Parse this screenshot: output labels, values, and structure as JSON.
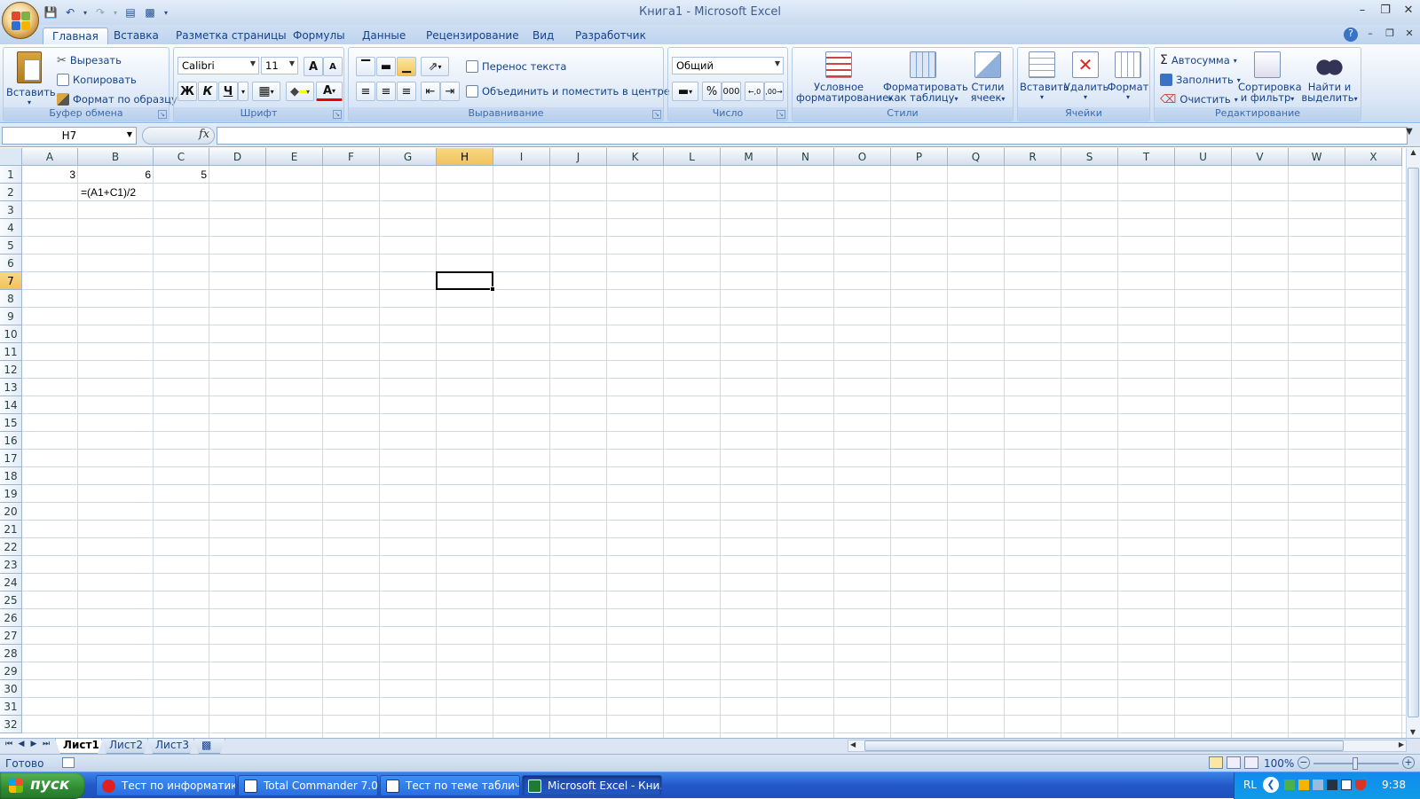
{
  "window": {
    "title": "Книга1 - Microsoft Excel"
  },
  "ribbon_tabs": [
    "Главная",
    "Вставка",
    "Разметка страницы",
    "Формулы",
    "Данные",
    "Рецензирование",
    "Вид",
    "Разработчик"
  ],
  "clipboard": {
    "paste": "Вставить",
    "cut": "Вырезать",
    "copy": "Копировать",
    "format_painter": "Формат по образцу",
    "label": "Буфер обмена"
  },
  "font": {
    "name": "Calibri",
    "size": "11",
    "bold": "Ж",
    "italic": "К",
    "underline": "Ч",
    "grow": "A",
    "shrink": "A",
    "label": "Шрифт"
  },
  "alignment": {
    "wrap": "Перенос текста",
    "merge": "Объединить и поместить в центре",
    "label": "Выравнивание"
  },
  "number": {
    "format": "Общий",
    "percent": "%",
    "thousands": "000",
    "inc_dec": ",0 ,00",
    "dec_dec": ",00 ,0",
    "label": "Число"
  },
  "styles": {
    "conditional": "Условное форматирование",
    "as_table": "Форматировать как таблицу",
    "cell_styles": "Стили ячеек",
    "label": "Стили"
  },
  "cells": {
    "insert": "Вставить",
    "delete": "Удалить",
    "format": "Формат",
    "label": "Ячейки"
  },
  "editing": {
    "autosum": "Автосумма",
    "fill": "Заполнить",
    "clear": "Очистить",
    "sort": "Сортировка и фильтр",
    "find": "Найти и выделить",
    "label": "Редактирование"
  },
  "formula_bar": {
    "name_box": "H7",
    "fx": "fx",
    "value": ""
  },
  "grid": {
    "columns": [
      "A",
      "B",
      "C",
      "D",
      "E",
      "F",
      "G",
      "H",
      "I",
      "J",
      "K",
      "L",
      "M",
      "N",
      "O",
      "P",
      "Q",
      "R",
      "S",
      "T",
      "U",
      "V",
      "W",
      "X"
    ],
    "rows": [
      "1",
      "2",
      "3",
      "4",
      "5",
      "6",
      "7",
      "8",
      "9",
      "10",
      "11",
      "12",
      "13",
      "14",
      "15",
      "16",
      "17",
      "18",
      "19",
      "20",
      "21",
      "22",
      "23",
      "24",
      "25",
      "26",
      "27",
      "28",
      "29",
      "30",
      "31",
      "32"
    ],
    "selected_col": "H",
    "selected_row": "7",
    "cells": {
      "A1": "3",
      "B1": "6",
      "C1": "5",
      "B2": "=(A1+C1)/2"
    }
  },
  "sheets": [
    "Лист1",
    "Лист2",
    "Лист3"
  ],
  "status": {
    "ready": "Готово",
    "zoom": "100%"
  },
  "taskbar": {
    "start": "пуск",
    "tasks": [
      "Тест по информатик...",
      "Total Commander 7.0...",
      "Тест по теме таблич...",
      "Microsoft Excel - Кни..."
    ],
    "lang": "RL",
    "clock": "9:38"
  }
}
